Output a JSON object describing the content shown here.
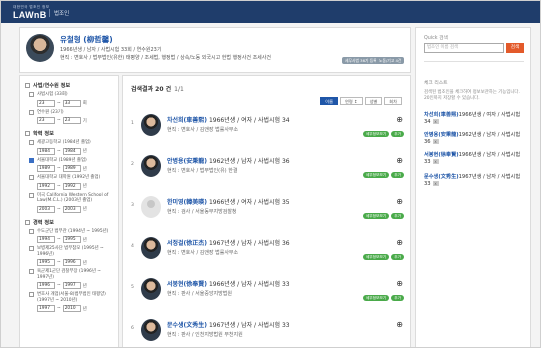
{
  "header": {
    "logo_small": "대한민국 법조인 정보",
    "logo_big": "LAWnB",
    "menu_label": "법조인"
  },
  "profile": {
    "name": "유철형 (柳哲馨)",
    "info1": "1966년생 / 남자 / 사법시험 33회 / 연수원23기",
    "info2": "현직 : 변호사 / 법무법인(유한) 태평양 / 조세법, 행정법 / 상속/노동 외국시고 헌법 행정사건 조세사건",
    "badge1": "세무사법 36기 등록",
    "badge2": "노동/기고 4건"
  },
  "filters": {
    "exam": {
      "title": "사법/연수원 정보",
      "opt1": "사법시험 (33회)",
      "from1": "23",
      "to1": "33",
      "opt2": "연수원 (23기)",
      "from2": "23",
      "to2": "23",
      "unit_hoe": "회",
      "unit_gi": "기",
      "dash": "~"
    },
    "school": {
      "title": "학력 정보",
      "opt1": "세광고등학교 (1984년 졸업)",
      "from1": "1984",
      "to1": "1984",
      "opt2": "서울대학교 (1989년 졸업)",
      "from2": "1989",
      "to2": "1989",
      "opt3": "서울대학교 대학원 (1992년 졸업)",
      "from3": "1992",
      "to3": "1992",
      "opt4": "미국 California Western School of Law(M.C.L.) (2003년 졸업)",
      "from4": "2003",
      "to4": "2003",
      "unit": "년"
    },
    "career": {
      "title": "경력 정보",
      "opt1": "수도군단 법무관 (1994년 ~ 1995년)",
      "from1": "1994",
      "to1": "1995",
      "opt2": "보병제25사단 법무참모 (1995년 ~ 1996년)",
      "from2": "1995",
      "to2": "1996",
      "opt3": "육군제1군단 검찰부장 (1996년 ~ 1997년)",
      "from3": "1996",
      "to3": "1997",
      "opt4": "변호사 개업(서울-8)법무법인 태평양) (1997년 ~ 2010년)",
      "from4": "1997",
      "to4": "2010"
    }
  },
  "results": {
    "title": "검색결과 20 건",
    "page": "1/1",
    "sort": [
      "이름",
      "연령 ↕",
      "성별",
      "회차"
    ],
    "detail_tag": "세부정보보기",
    "add_tag": "추가",
    "zoom_glyph": "⊕",
    "items": [
      {
        "num": "1",
        "name": "차선희(車善熙)",
        "meta": " 1966년생 / 여자 / 사법시험 34",
        "sub": "현직 : 변호사 / 김앤장 법률사무소"
      },
      {
        "num": "2",
        "name": "안병용(安秉龍)",
        "meta": " 1962년생 / 남자 / 사법시험 36",
        "sub": "현직 : 변호사 / 법무법인(유) 한결"
      },
      {
        "num": "3",
        "name": "한미영(韓美暎)",
        "meta": " 1966년생 / 여자 / 사법시험 35",
        "sub": "현직 : 검사 / 서울동부지방검찰청"
      },
      {
        "num": "4",
        "name": "서정걸(徐正杰)",
        "meta": " 1967년생 / 남자 / 사법시험 36",
        "sub": "현직 : 변호사 / 김앤장 법률사무소"
      },
      {
        "num": "5",
        "name": "서봉현(徐奉賢)",
        "meta": " 1966년생 / 남자 / 사법시험 33",
        "sub": "현직 : 판사 / 서울중앙지방법원"
      },
      {
        "num": "6",
        "name": "문수생(文秀生)",
        "meta": " 1967년생 / 남자 / 사법시험 33",
        "sub": "현직 : 판사 / 인천지방법원 부천지원"
      }
    ]
  },
  "quick": {
    "label": "Quick 검색",
    "placeholder": "법조인 이름 검색",
    "button": "검색"
  },
  "checklist": {
    "label": "체크 리스트",
    "desc": "검색된 법조인을 체크하여 정보보관하는 기능입니다. 20인까지 저장할 수 있습니다.",
    "remove": "x",
    "items": [
      {
        "name": "차선희(車善熙)",
        "meta": "1966년생 / 여자 / 사법시험 34"
      },
      {
        "name": "안병용(安秉龍)",
        "meta": "1962년생 / 남자 / 사법시험 36"
      },
      {
        "name": "서봉현(徐奉賢)",
        "meta": "1966년생 / 남자 / 사법시험 33"
      },
      {
        "name": "문수생(文秀生)",
        "meta": "1967년생 / 남자 / 사법시험 33"
      }
    ]
  }
}
